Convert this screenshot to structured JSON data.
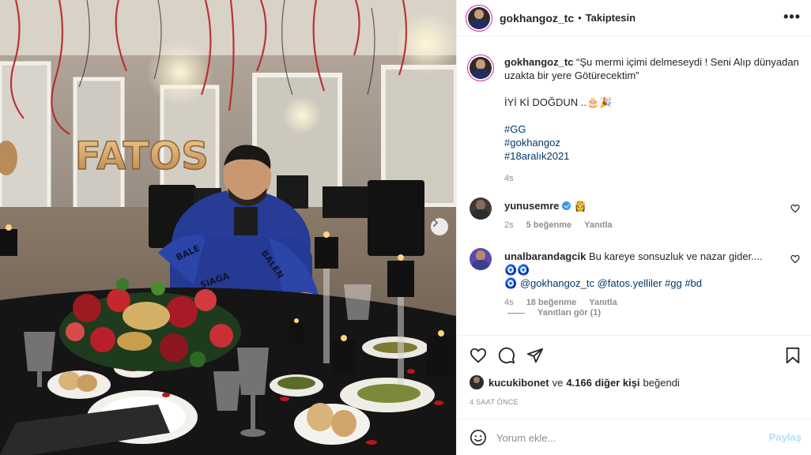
{
  "header": {
    "username": "gokhangoz_tc",
    "separator": "•",
    "follow_status": "Takiptesin",
    "more_icon": "more-horizontal-icon"
  },
  "photo": {
    "balloon_text": "FATOS"
  },
  "caption": {
    "username": "gokhangoz_tc",
    "text": "“Şu mermi içimi delmeseydi ! Seni Alıp dünyadan uzakta bir yere Götürecektim”",
    "line2": "İYİ Kİ DOĞDUN ..🎂🎉",
    "hashtags": [
      "#GG",
      "#gokhangoz",
      "#18aralık2021"
    ],
    "time": "4s"
  },
  "comments": [
    {
      "username": "yunusemre",
      "text": "👸",
      "time": "2s",
      "likes": "5 beğenme",
      "reply": "Yanıtla"
    },
    {
      "username": "unalbarandagcik",
      "text": "Bu kareye sonsuzluk ve nazar gider.... 🧿🧿",
      "mention_prefix": "🧿 ",
      "mentions": "@gokhangoz_tc @fatos.yelliler #gg #bd",
      "time": "4s",
      "likes": "18 beğenme",
      "reply": "Yanıtla"
    }
  ],
  "view_replies": "Yanıtları gör (1)",
  "likes": {
    "user": "kucukibonet",
    "connector": "ve",
    "others": "4.166 diğer kişi",
    "suffix": "beğendi"
  },
  "post_time": "4 SAAT ÖNCE",
  "composer": {
    "placeholder": "Yorum ekle...",
    "post_label": "Paylaş"
  },
  "colors": {
    "link": "#00376b",
    "muted": "#8e8e8e",
    "post_disabled": "#b2dffc",
    "verified": "#3897f0"
  }
}
